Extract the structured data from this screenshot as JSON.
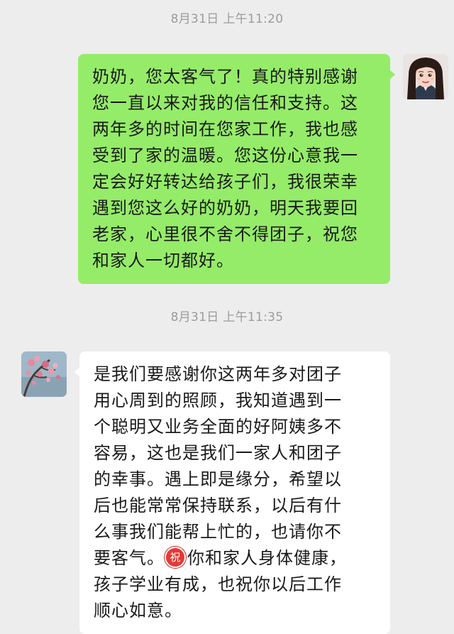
{
  "conversation": {
    "timestamp_1": "8月31日 上午11:20",
    "timestamp_2": "8月31日 上午11:35",
    "sent_message": {
      "lines": [
        "奶奶，您太客气了！真的特别感谢",
        "您一直以来对我的信任和支持。这",
        "两年多的时间在您家工作，我也感",
        "受到了家的温暖。您这份心意我一",
        "定会好好转达给孩子们，我很荣幸",
        "遇到您这么好的奶奶，明天我要回",
        "老家，心里很不舍不得团子，祝您",
        "和家人一切都好。"
      ]
    },
    "received_message": {
      "lines": [
        "是我们要感谢你这两年多对团子",
        "用心周到的照顾，我知道遇到一",
        "个聪明又业务全面的好阿姨多不",
        "容易，这也是我们一家人和团子",
        "的幸事。遇上即是缘分，希望以",
        "后也能常常保持联系，以后有什",
        "么事我们能帮上忙的，也请你不"
      ],
      "line_8_prefix": "要客气。",
      "line_8_suffix": "你和家人身体健康，",
      "emoji_char": "祝",
      "line_9": "孩子学业有成，也祝你以后工作",
      "line_10": "顺心如意。"
    }
  },
  "colors": {
    "chat_background": "#ededed",
    "sent_bubble": "#95ec69",
    "received_bubble": "#ffffff",
    "timestamp_text": "#9b9b9b",
    "emoji_badge": "#e53935"
  },
  "icons": {
    "self_avatar": "cartoon-woman-avatar",
    "contact_avatar": "cherry-blossom-avatar",
    "blessing_emoji": "zhu-blessing-emoji"
  }
}
